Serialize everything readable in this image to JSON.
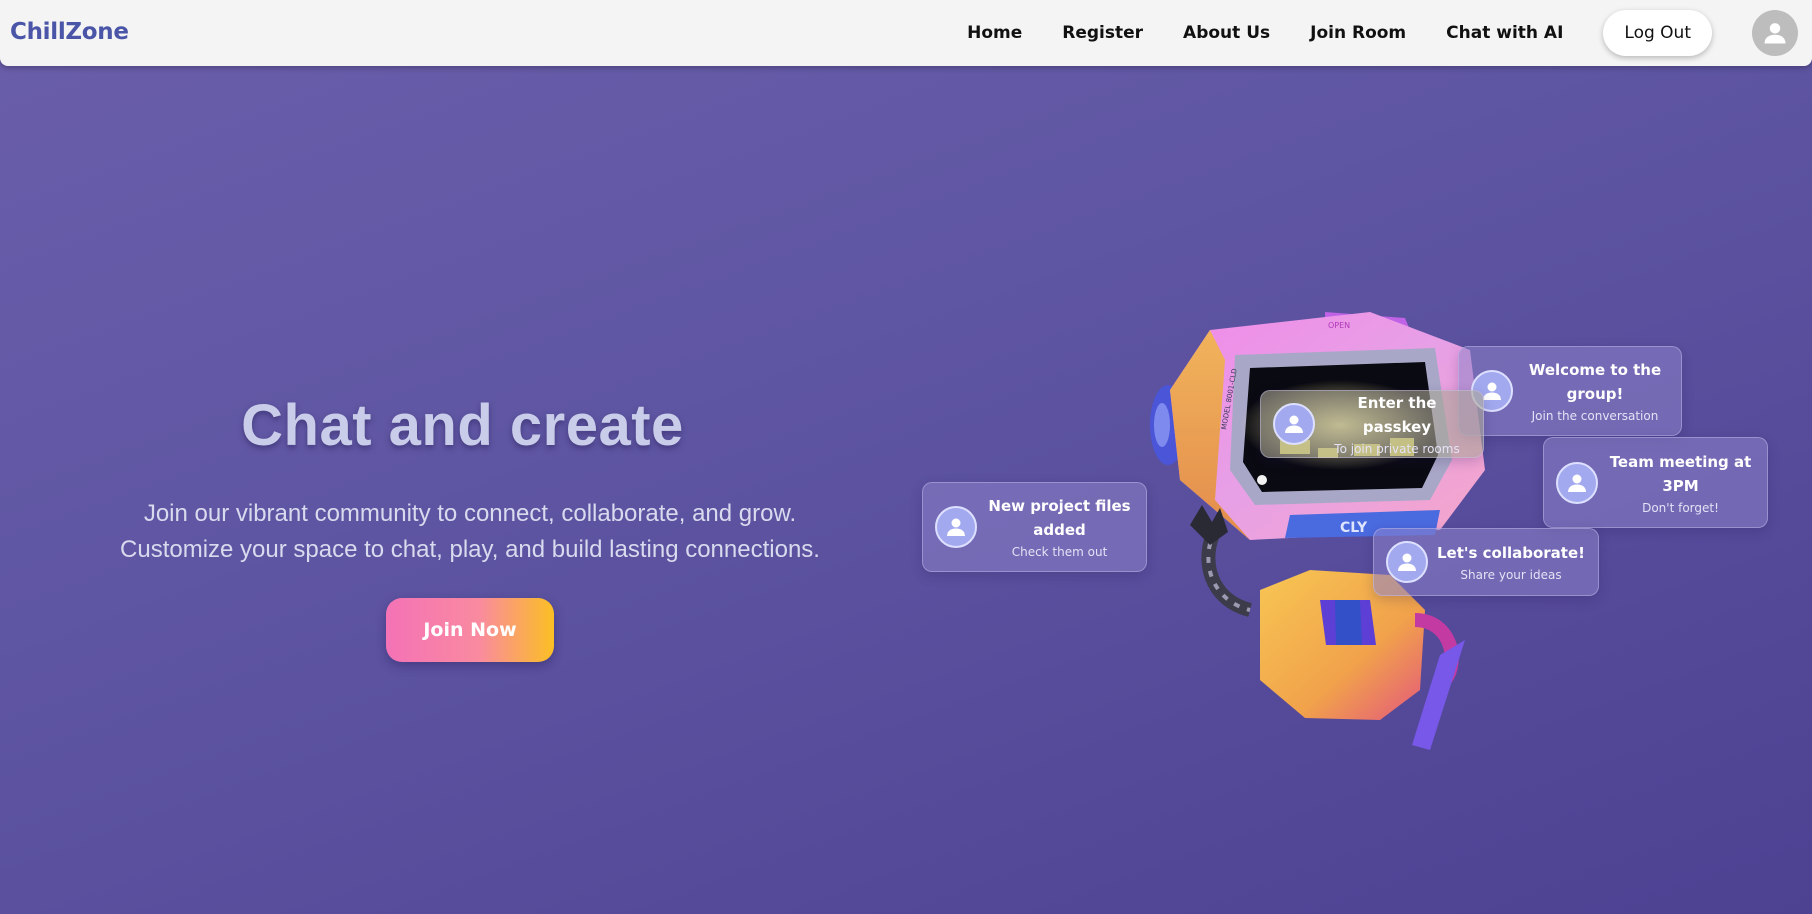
{
  "navbar": {
    "brand": "ChillZone",
    "links": [
      "Home",
      "Register",
      "About Us",
      "Join Room",
      "Chat with AI"
    ],
    "logout_label": "Log Out",
    "avatar_icon": "user-avatar-icon"
  },
  "hero": {
    "title": "Chat and create",
    "subtitle_line1": "Join our vibrant community to connect, collaborate, and grow.",
    "subtitle_line2": "Customize your space to chat, play, and build lasting connections.",
    "cta_label": "Join Now"
  },
  "robot": {
    "screen_label": "OPEN",
    "side_label": "MODEL 8001-CLD",
    "chest_label": "CLY"
  },
  "cards": [
    {
      "title": "Welcome to the group!",
      "subtitle": "Join the conversation"
    },
    {
      "title": "Enter the passkey",
      "subtitle": "To join private rooms"
    },
    {
      "title": "Team meeting at 3PM",
      "subtitle": "Don't forget!"
    },
    {
      "title": "New project files added",
      "subtitle": "Check them out"
    },
    {
      "title": "Let's collaborate!",
      "subtitle": "Share your ideas"
    }
  ],
  "colors": {
    "brand": "#4a55a8",
    "background": "#5f56a3",
    "cta_gradient_start": "#f472b6",
    "cta_gradient_end": "#fbbf24"
  }
}
